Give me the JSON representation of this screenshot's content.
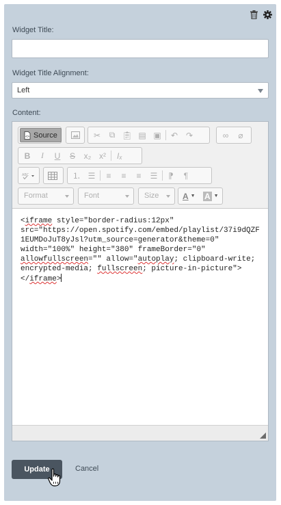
{
  "header": {
    "delete_icon": "trash-icon",
    "settings_icon": "gear-icon"
  },
  "form": {
    "title_label": "Widget Title:",
    "title_value": "",
    "alignment_label": "Widget Title Alignment:",
    "alignment_value": "Left",
    "content_label": "Content:"
  },
  "toolbar": {
    "source_label": "Source",
    "format_label": "Format",
    "font_label": "Font",
    "size_label": "Size",
    "text_color_glyph": "A",
    "bg_color_glyph": "A"
  },
  "editor": {
    "lines": [
      "<iframe style=\"border-radius:12px\"",
      "src=\"https://open.spotify.com/embed/playlist/37i9dQZF",
      "1EUMDoJuT8yJsl?utm_source=generator&theme=0\"",
      "width=\"100%\" height=\"380\" frameBorder=\"0\"",
      "allowfullscreen=\"\" allow=\"autoplay; clipboard-write;",
      "encrypted-media; fullscreen; picture-in-picture\">",
      "</iframe>"
    ]
  },
  "actions": {
    "update_label": "Update",
    "cancel_label": "Cancel"
  }
}
